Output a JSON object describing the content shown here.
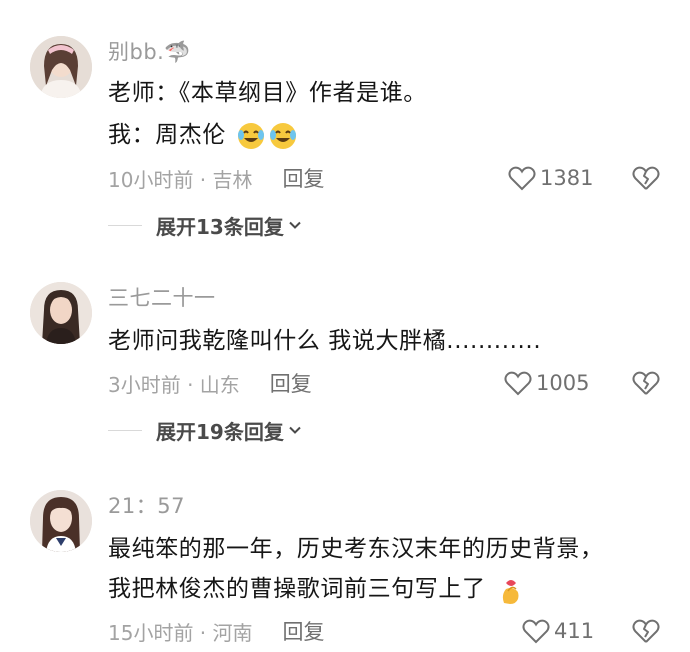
{
  "comments": [
    {
      "username": "别bb.🦈",
      "lines": [
        "老师：《本草纲目》作者是谁。",
        "我：周杰伦"
      ],
      "time_location": "10小时前 · 吉林",
      "reply_label": "回复",
      "like_count": "1381",
      "expand_label": "展开13条回复",
      "emojis": [
        "crying-laughing-emoji",
        "crying-laughing-emoji"
      ]
    },
    {
      "username": "三七二十一",
      "lines": [
        "老师问我乾隆叫什么 我说大胖橘............"
      ],
      "time_location": "3小时前 · 山东",
      "reply_label": "回复",
      "like_count": "1005",
      "expand_label": "展开19条回复"
    },
    {
      "username": "21：57",
      "lines": [
        "最纯笨的那一年，历史考东汉末年的历史背景，",
        "我把林俊杰的曹操歌词前三句写上了"
      ],
      "time_location": "15小时前 · 河南",
      "reply_label": "回复",
      "like_count": "411",
      "emojis": [
        "finger-heart-emoji"
      ]
    }
  ],
  "colors": {
    "username": "#9a9a9a",
    "text": "#161616",
    "meta": "#a3a3a3",
    "icon": "#707070"
  }
}
